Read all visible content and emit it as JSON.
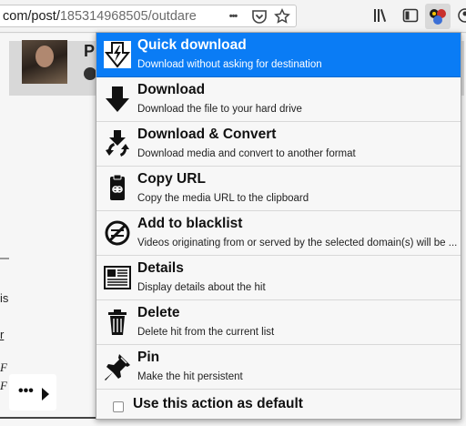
{
  "browser": {
    "url_host": "com/post/",
    "url_path": "185314968505/outdare",
    "more_glyph": "•••",
    "icons": [
      "pocket-icon",
      "star-icon",
      "library-icon",
      "sidebar-icon",
      "extension-icon",
      "account-icon"
    ]
  },
  "page": {
    "header_letter": "P",
    "fragments": [
      "is",
      "r",
      "F",
      "F"
    ],
    "more_label": "•••"
  },
  "menu": {
    "items": [
      {
        "title": "Quick download",
        "desc": "Download without asking for destination",
        "icon": "quick-download-icon"
      },
      {
        "title": "Download",
        "desc": "Download the file to your hard drive",
        "icon": "download-arrow-icon"
      },
      {
        "title": "Download & Convert",
        "desc": "Download media and convert to another format",
        "icon": "download-convert-icon"
      },
      {
        "title": "Copy URL",
        "desc": "Copy the media URL to the clipboard",
        "icon": "copy-url-icon"
      },
      {
        "title": "Add to blacklist",
        "desc": "Videos originating from or served by the selected domain(s) will be ...",
        "icon": "blacklist-icon"
      },
      {
        "title": "Details",
        "desc": "Display details about the hit",
        "icon": "details-icon"
      },
      {
        "title": "Delete",
        "desc": "Delete hit from the current list",
        "icon": "trash-icon"
      },
      {
        "title": "Pin",
        "desc": "Make the hit persistent",
        "icon": "pin-icon"
      }
    ],
    "default_label": "Use this action as default",
    "default_checked": false,
    "accent": "#0a7cf5"
  }
}
